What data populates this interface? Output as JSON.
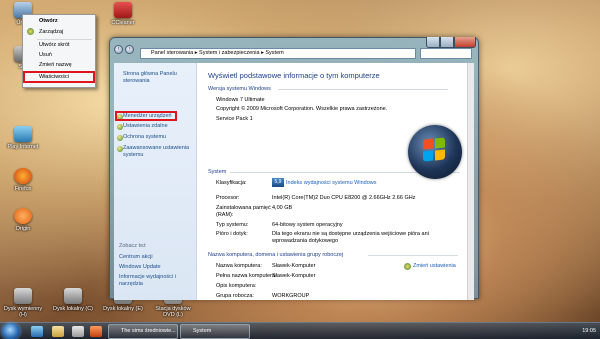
{
  "desktop": {
    "icons": [
      {
        "label": "Úrodi"
      },
      {
        "label": "CCleaner"
      },
      {
        "label": "Sys"
      },
      {
        "label": "Play Internet"
      },
      {
        "label": "Firefox"
      },
      {
        "label": "Origin"
      },
      {
        "label": "Dysk wymienny (H)"
      },
      {
        "label": "Dysk lokalny (C)"
      },
      {
        "label": "Dysk lokalny (E)"
      },
      {
        "label": "Stacja dysków DVD (L)"
      }
    ]
  },
  "context_menu": {
    "items": [
      {
        "label": "Otwórz"
      },
      {
        "label": "Zarządzaj"
      },
      {
        "label": "Utwórz skrót"
      },
      {
        "label": "Usuń"
      },
      {
        "label": "Zmień nazwę"
      },
      {
        "label": "Właściwości"
      }
    ]
  },
  "window": {
    "breadcrumb": [
      "Panel sterowania",
      "System i zabezpieczenia",
      "System"
    ],
    "left_pane": {
      "home": "Strona główna Panelu sterowania",
      "links": [
        "Menedżer urządzeń",
        "Ustawienia zdalne",
        "Ochrona systemu",
        "Zaawansowane ustawienia systemu"
      ],
      "see_also_title": "Zobacz też",
      "see_also": [
        "Centrum akcji",
        "Windows Update",
        "Informacje wydajności i narzędzia"
      ]
    },
    "main": {
      "heading": "Wyświetl podstawowe informacje o tym komputerze",
      "edition": {
        "title": "Wersja systemu Windows",
        "name": "Windows 7 Ultimate",
        "copyright": "Copyright © 2009 Microsoft Corporation. Wszelkie prawa zastrzeżone.",
        "service_pack": "Service Pack 1"
      },
      "system": {
        "title": "System",
        "rows": [
          {
            "label": "Klasyfikacja:",
            "value": "Indeks wydajności systemu Windows"
          },
          {
            "label": "Procesor:",
            "value": "Intel(R) Core(TM)2 Duo CPU    E8200  @ 2.66GHz   2.66 GHz"
          },
          {
            "label": "Zainstalowana pamięć (RAM):",
            "value": "4,00 GB"
          },
          {
            "label": "Typ systemu:",
            "value": "64-bitowy system operacyjny"
          },
          {
            "label": "Pióro i dotyk:",
            "value": "Dla tego ekranu nie są dostępne urządzenia wejściowe pióra ani wprowadzania dotykowego"
          }
        ],
        "wei_score": "5,9"
      },
      "computer": {
        "title": "Nazwa komputera, domena i ustawienia grupy roboczej",
        "change_link": "Zmień ustawienia",
        "rows": [
          {
            "label": "Nazwa komputera:",
            "value": "Sławek-Komputer"
          },
          {
            "label": "Pełna nazwa komputera:",
            "value": "Sławek-Komputer"
          },
          {
            "label": "Opis komputera:",
            "value": ""
          },
          {
            "label": "Grupa robocza:",
            "value": "WORKGROUP"
          }
        ]
      }
    }
  },
  "taskbar": {
    "buttons": [
      {
        "label": "The sims średniowie..."
      },
      {
        "label": "System"
      }
    ],
    "clock": "19:05"
  },
  "colors": {
    "highlight_red": "#e0141e",
    "link_blue": "#1b5eb8",
    "heading_blue": "#1e3f8c"
  }
}
